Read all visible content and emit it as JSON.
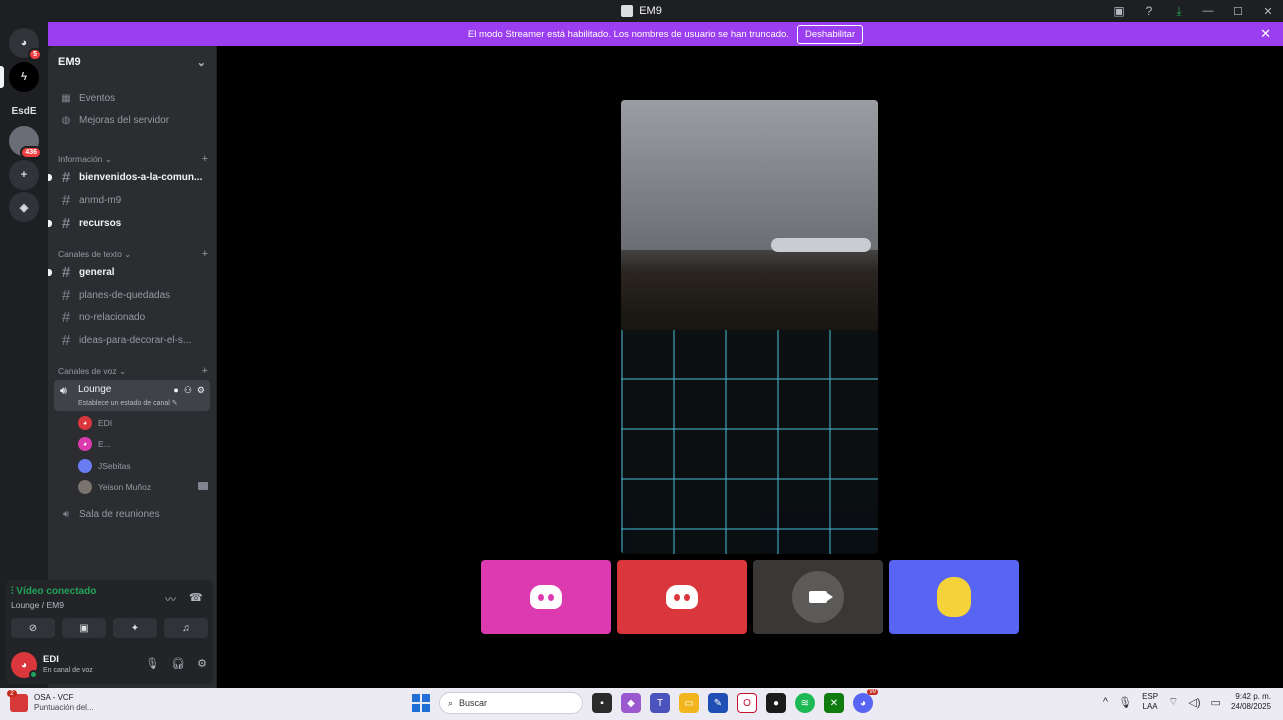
{
  "window": {
    "title": "EM9"
  },
  "banner": {
    "message": "El modo Streamer está habilitado. Los nombres de usuario se han truncado.",
    "button": "Deshabilitar"
  },
  "rail": {
    "dm_badge": "5",
    "server_label": "EsdE",
    "server_badge": "436"
  },
  "server": {
    "name": "EM9",
    "top_items": [
      "Eventos",
      "Mejoras del servidor"
    ],
    "categories": {
      "info": "Información",
      "text": "Canales de texto",
      "voice": "Canales de voz"
    },
    "info_channels": [
      "bienvenidos-a-la-comun...",
      "anmd-m9",
      "recursos"
    ],
    "text_channels": [
      "general",
      "planes-de-quedadas",
      "no-relacionado",
      "ideas-para-decorar-el-s..."
    ],
    "voice_channel": {
      "name": "Lounge",
      "status": "Establece un estado de canal"
    },
    "voice_users": [
      "EDI",
      "E...",
      "JSebitas",
      "Yeison Muñoz"
    ],
    "other_voice": "Sala de reuniones"
  },
  "voice_panel": {
    "status": "Vídeo conectado",
    "location": "Lounge / EM9",
    "user_name": "EDI",
    "user_status": "En canal de voz"
  },
  "taskbar": {
    "notif_badge": "2",
    "app_title": "OSA - VCF",
    "app_sub": "Puntuación del...",
    "search_placeholder": "Buscar",
    "lang_top": "ESP",
    "lang_bottom": "LAA",
    "time": "9:42 p. m.",
    "date": "24/08/2025",
    "discord_badge": "99"
  },
  "colors": {
    "banner": "#9b3ef0",
    "tile1": "#dc3bb0",
    "tile2": "#da373c",
    "tile3": "#3a3836",
    "tile4": "#5865f2"
  }
}
